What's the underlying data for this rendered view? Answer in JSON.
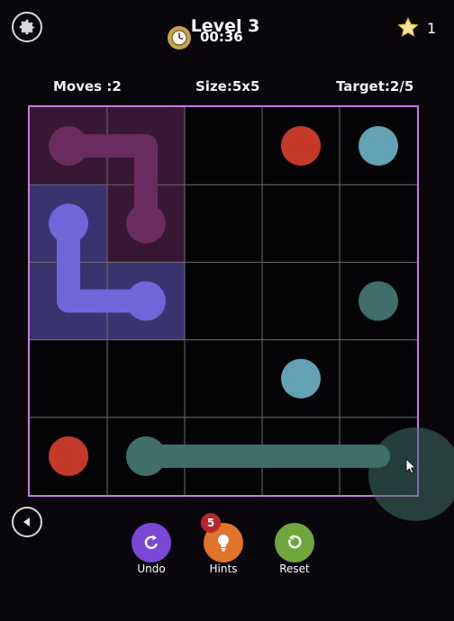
{
  "header": {
    "title": "Level 3",
    "timer": "00:36",
    "star_count": "1",
    "icons": {
      "settings": "gear-icon",
      "timer": "clock-icon",
      "stars": "star-icon"
    }
  },
  "stats": {
    "moves": "Moves :2",
    "size": "Size:5x5",
    "target": "Target:2/5"
  },
  "board": {
    "grid": 5,
    "colors": {
      "frame": "#c878e8",
      "grid_line": "#6f6f6f",
      "purple": "#6a2b5e",
      "blue": "#6e66d9",
      "red": "#c5392a",
      "lightblue": "#63a2b5",
      "teal": "#3f6f68"
    },
    "flows": [
      {
        "color": "purple",
        "path": [
          [
            0,
            0
          ],
          [
            0,
            1
          ],
          [
            1,
            1
          ]
        ],
        "endpoints": [
          [
            0,
            0
          ],
          [
            1,
            1
          ]
        ],
        "filled_cells": [
          [
            0,
            0
          ],
          [
            0,
            1
          ],
          [
            1,
            1
          ]
        ]
      },
      {
        "color": "blue",
        "path": [
          [
            1,
            0
          ],
          [
            2,
            0
          ],
          [
            2,
            1
          ]
        ],
        "endpoints": [
          [
            1,
            0
          ],
          [
            2,
            1
          ]
        ],
        "filled_cells": [
          [
            1,
            0
          ],
          [
            2,
            0
          ],
          [
            2,
            1
          ]
        ]
      },
      {
        "color": "teal",
        "path": [
          [
            4,
            1
          ],
          [
            4,
            4
          ]
        ],
        "endpoints": [
          [
            4,
            1
          ]
        ],
        "filled_cells": []
      }
    ],
    "dots": [
      {
        "color": "red",
        "cell": [
          0,
          3
        ]
      },
      {
        "color": "lightblue",
        "cell": [
          0,
          4
        ]
      },
      {
        "color": "teal",
        "cell": [
          2,
          4
        ]
      },
      {
        "color": "lightblue",
        "cell": [
          3,
          3
        ]
      },
      {
        "color": "red",
        "cell": [
          4,
          0
        ]
      }
    ],
    "cursor": {
      "cell": [
        4,
        4
      ],
      "color": "teal"
    }
  },
  "controls": {
    "undo_label": "Undo",
    "hints_label": "Hints",
    "hints_badge": "5",
    "reset_label": "Reset",
    "colors": {
      "undo": "#7b47d6",
      "hints": "#e0742a",
      "reset": "#6fa63d"
    },
    "icons": {
      "back": "back-arrow-icon",
      "undo": "undo-icon",
      "hints": "lightbulb-icon",
      "reset": "reset-icon"
    }
  }
}
